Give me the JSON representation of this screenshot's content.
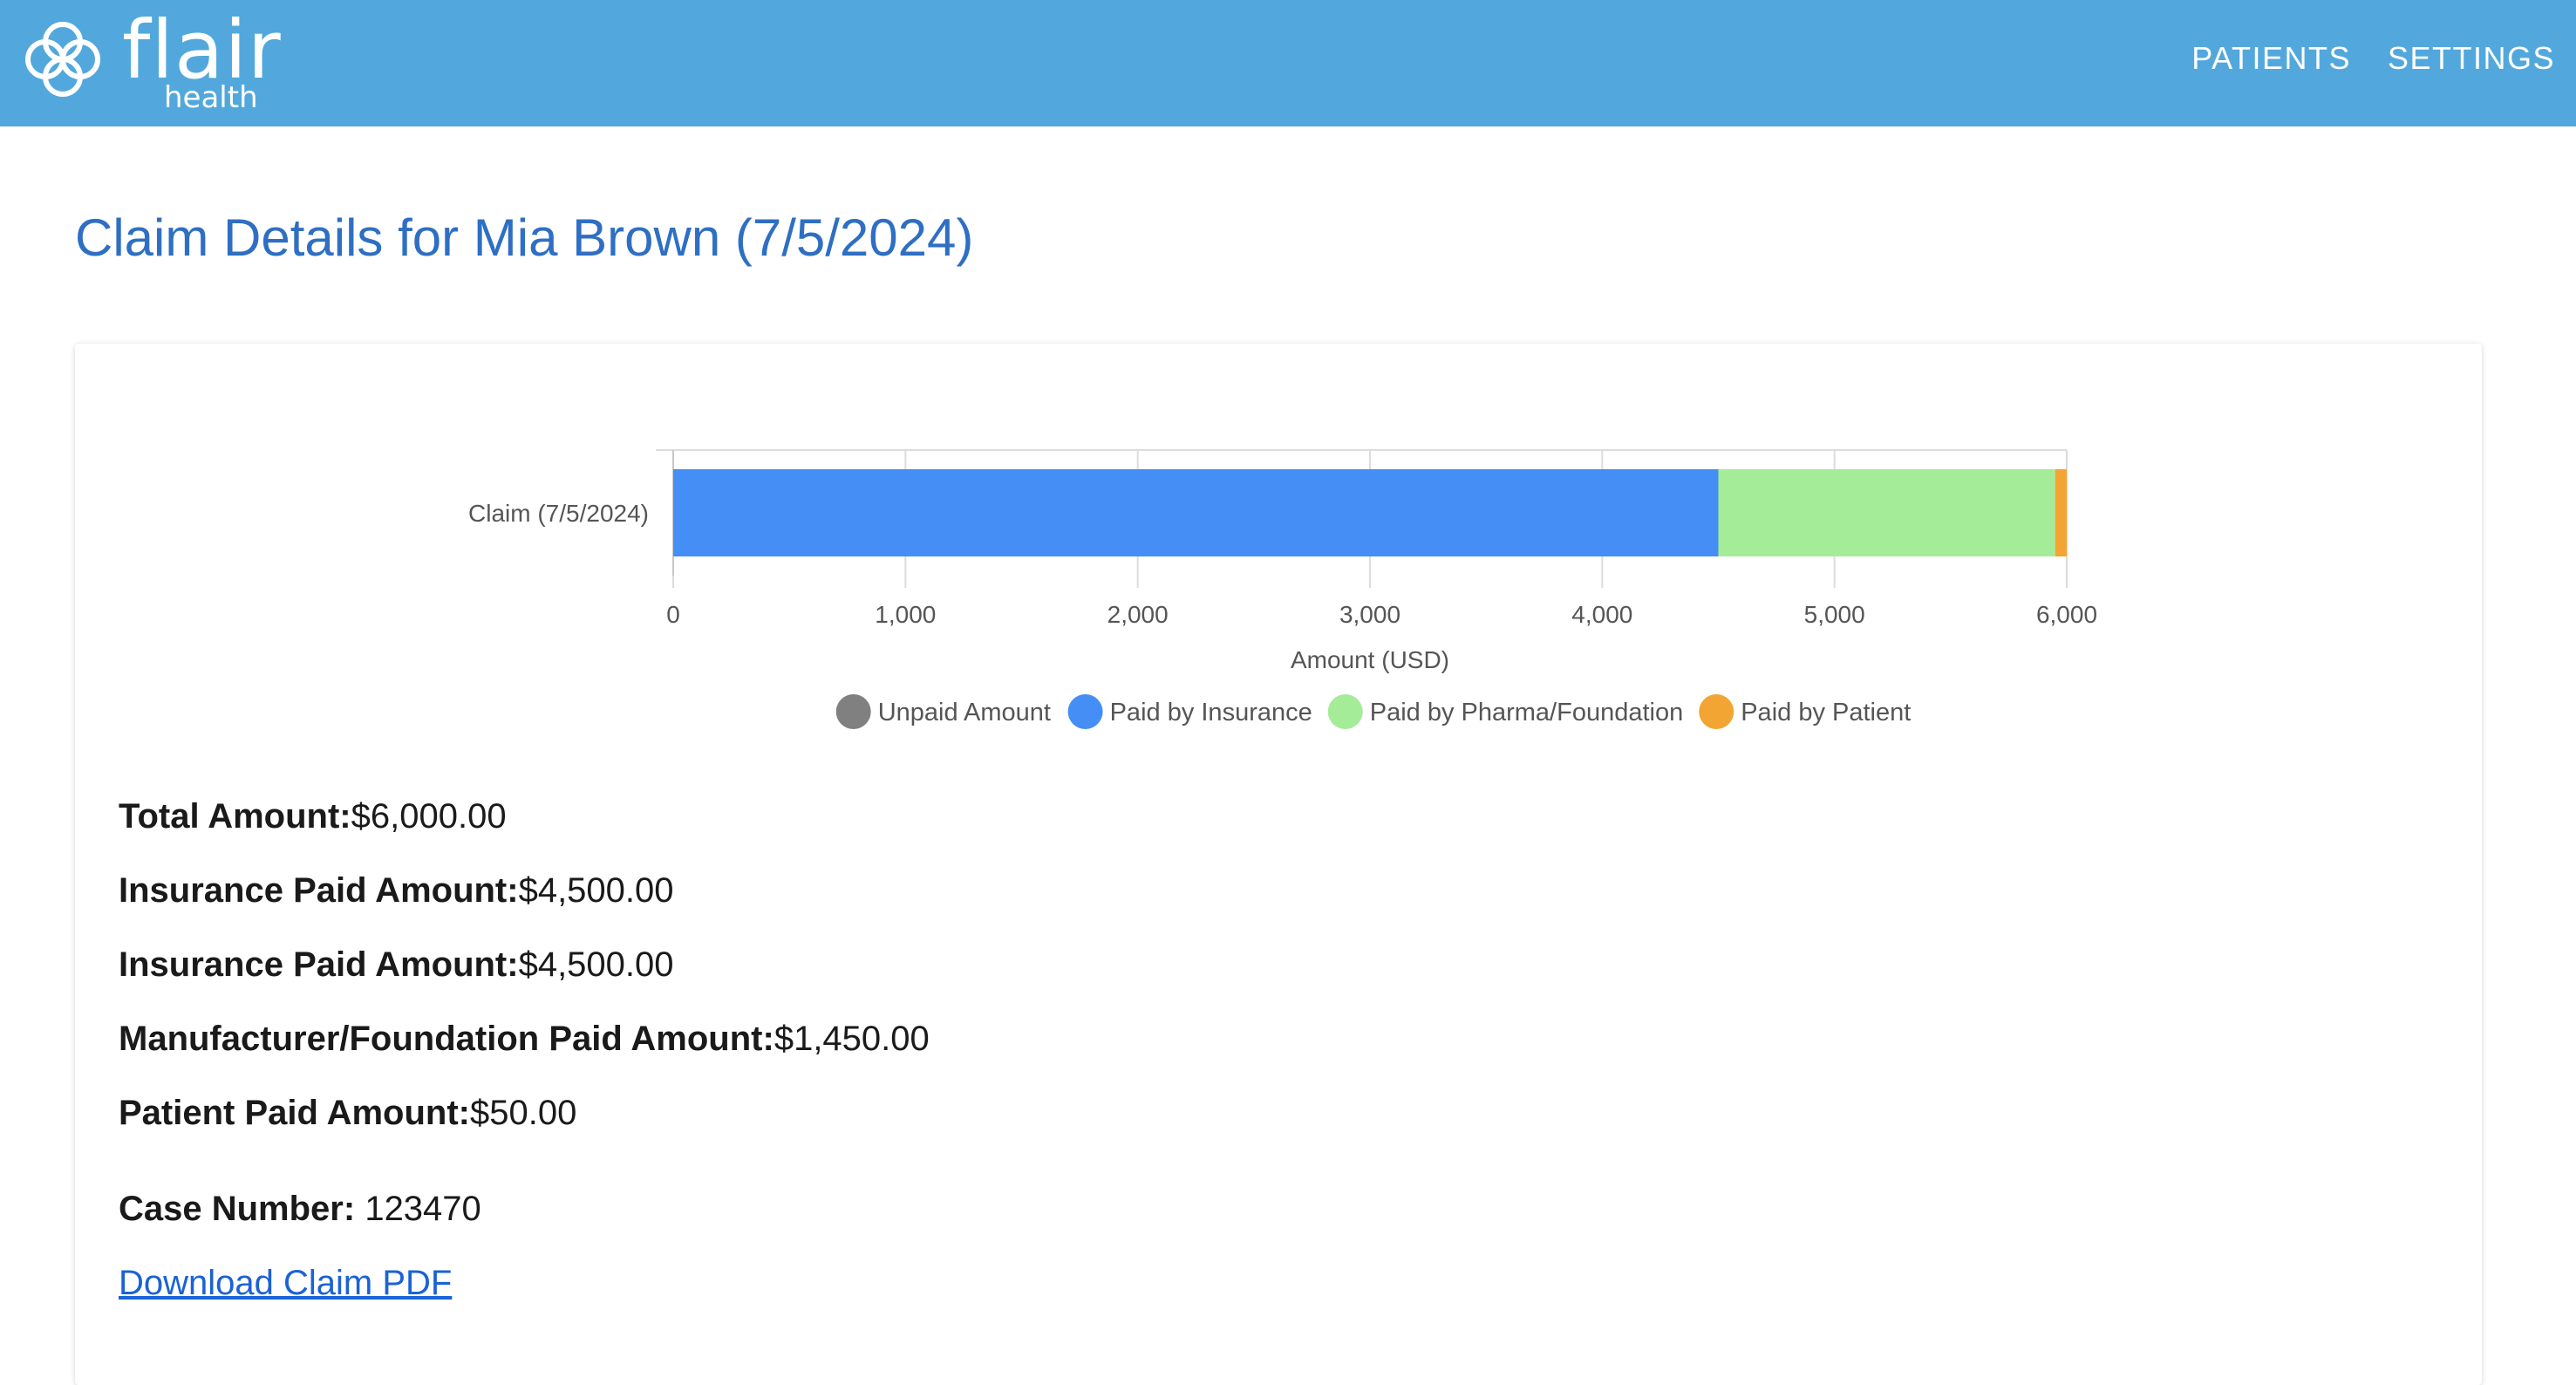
{
  "header": {
    "logo_word": "flair",
    "logo_sub": "health",
    "nav": [
      "PATIENTS",
      "SETTINGS"
    ]
  },
  "title": "Claim Details for Mia Brown (7/5/2024)",
  "chart_data": {
    "type": "bar",
    "orientation": "horizontal",
    "stacked": true,
    "categories": [
      "Claim (7/5/2024)"
    ],
    "series": [
      {
        "name": "Unpaid Amount",
        "values": [
          0
        ],
        "color": "#808080"
      },
      {
        "name": "Paid by Insurance",
        "values": [
          4500
        ],
        "color": "#448ef6"
      },
      {
        "name": "Paid by Pharma/Foundation",
        "values": [
          1450
        ],
        "color": "#a5ec98"
      },
      {
        "name": "Paid by Patient",
        "values": [
          50
        ],
        "color": "#f2a533"
      }
    ],
    "xlabel": "Amount (USD)",
    "ylabel": "",
    "xlim": [
      0,
      6000
    ],
    "xticks": [
      "0",
      "1,000",
      "2,000",
      "3,000",
      "4,000",
      "5,000",
      "6,000"
    ],
    "grid": true,
    "legend": "bottom"
  },
  "details": [
    {
      "label": "Total Amount:",
      "value": "$6,000.00"
    },
    {
      "label": "Insurance Paid Amount:",
      "value": "$4,500.00"
    },
    {
      "label": "Insurance Paid Amount:",
      "value": "$4,500.00"
    },
    {
      "label": "Manufacturer/Foundation Paid Amount:",
      "value": "$1,450.00"
    },
    {
      "label": "Patient Paid Amount:",
      "value": "$50.00"
    }
  ],
  "case": {
    "label": "Case Number:",
    "value": " 123470"
  },
  "download_label": "Download Claim PDF"
}
